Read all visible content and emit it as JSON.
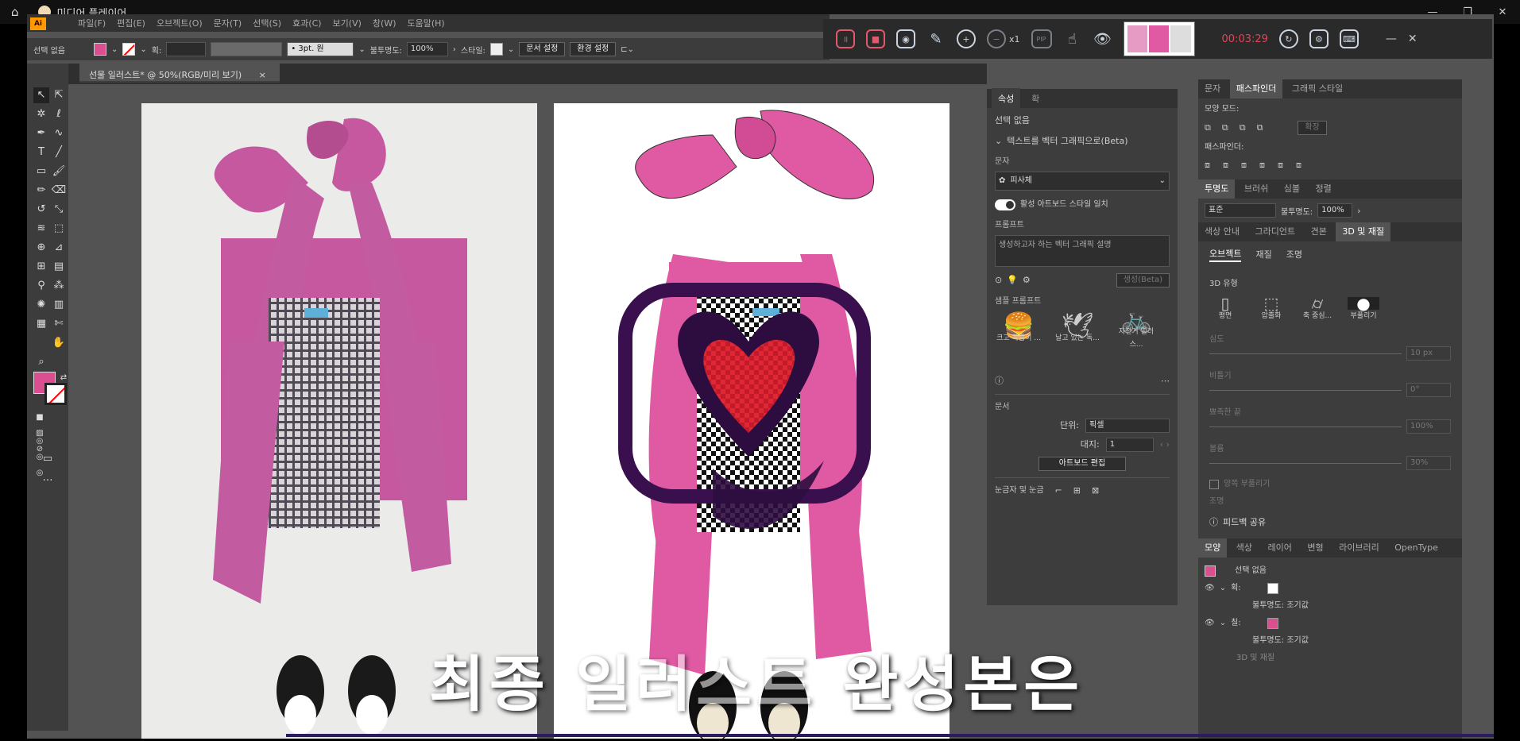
{
  "player": {
    "title": "미디어 플레이어",
    "home_icon": "home-icon",
    "minimize": "—",
    "restore": "❐",
    "close": "✕"
  },
  "menu": {
    "items": [
      "파일(F)",
      "편집(E)",
      "오브젝트(O)",
      "문자(T)",
      "선택(S)",
      "효과(C)",
      "보기(V)",
      "창(W)",
      "도움말(H)"
    ]
  },
  "control": {
    "selection": "선택 없음",
    "stroke_label": "획:",
    "stroke_style": "• 3pt. 원",
    "opacity_label": "불투명도:",
    "opacity_value": "100%",
    "style_label": "스타일:",
    "doc_setup": "문서 설정",
    "prefs": "환경 설정"
  },
  "recorder": {
    "time": "00:03:29",
    "zoom": "x1",
    "pip": "PIP"
  },
  "doc": {
    "tab": "선물 일러스트* @ 50%(RGB/미리 보기)",
    "close": "×"
  },
  "caption": {
    "text1": "최종",
    "text2": "일러스트",
    "text3": "완성본은"
  },
  "props": {
    "tabs": [
      "속성",
      "확"
    ],
    "selection": "선택 없음",
    "text_to_vector": "텍스트를 벡터 그래픽으로(Beta)",
    "subject_label": "문자",
    "subject_value": "피사체",
    "active_style": "활성 아트보드 스타일 일치",
    "prompt_label": "프롬프트",
    "prompt_placeholder": "생성하고자 하는 벡터 그래픽 설명",
    "generate": "생성(Beta)",
    "sample_label": "샘플 프롬프트",
    "samples": [
      "크고 육즙이 ...",
      "날고 있는 독...",
      "자전거 일러스..."
    ],
    "doc_label": "문서",
    "unit_label": "단위:",
    "unit_value": "픽셀",
    "artboard_label": "대지:",
    "artboard_value": "1",
    "edit_artboard": "아트보드 편집",
    "rulers_label": "눈금자 및 눈금"
  },
  "right": {
    "top_tabs": [
      "문자",
      "패스파인더",
      "그래픽 스타일"
    ],
    "shape_modes": "모양 모드:",
    "expand": "확장",
    "pathfinders": "패스파인더:",
    "tabs2": [
      "투명도",
      "브러쉬",
      "심볼",
      "정렬"
    ],
    "blend": "표준",
    "opacity_label": "불투명도:",
    "opacity_value": "100%",
    "tabs3": [
      "색상 안내",
      "그라디언트",
      "견본",
      "3D 및 재질"
    ],
    "sub_tabs": [
      "오브젝트",
      "재질",
      "조명"
    ],
    "type_label": "3D 유형",
    "types": [
      "평면",
      "압출화",
      "축 중심...",
      "부풀리기"
    ],
    "depth": "심도",
    "depth_val": "10 px",
    "twist": "비틀기",
    "twist_val": "0°",
    "taper": "뾰족한 끝",
    "taper_val": "100%",
    "volume": "볼륨",
    "volume_val": "30%",
    "cap": "양쪽 부풀리기",
    "lighting": "조명",
    "feedback": "피드백 공유",
    "tabs4": [
      "모양",
      "색상",
      "레이어",
      "변형",
      "라이브러리",
      "OpenType"
    ],
    "appearance_title": "선택 없음",
    "stroke_label": "획:",
    "opacity_default1": "불투명도: 조기값",
    "fill_label": "칠:",
    "opacity_default2": "불투명도: 조기값",
    "partial": "3D 및 재질"
  },
  "colors": {
    "pink": "#e05aa3",
    "fill_swatch": "#d94f8f",
    "dark": "#3a0f4e",
    "red": "#e02835"
  }
}
